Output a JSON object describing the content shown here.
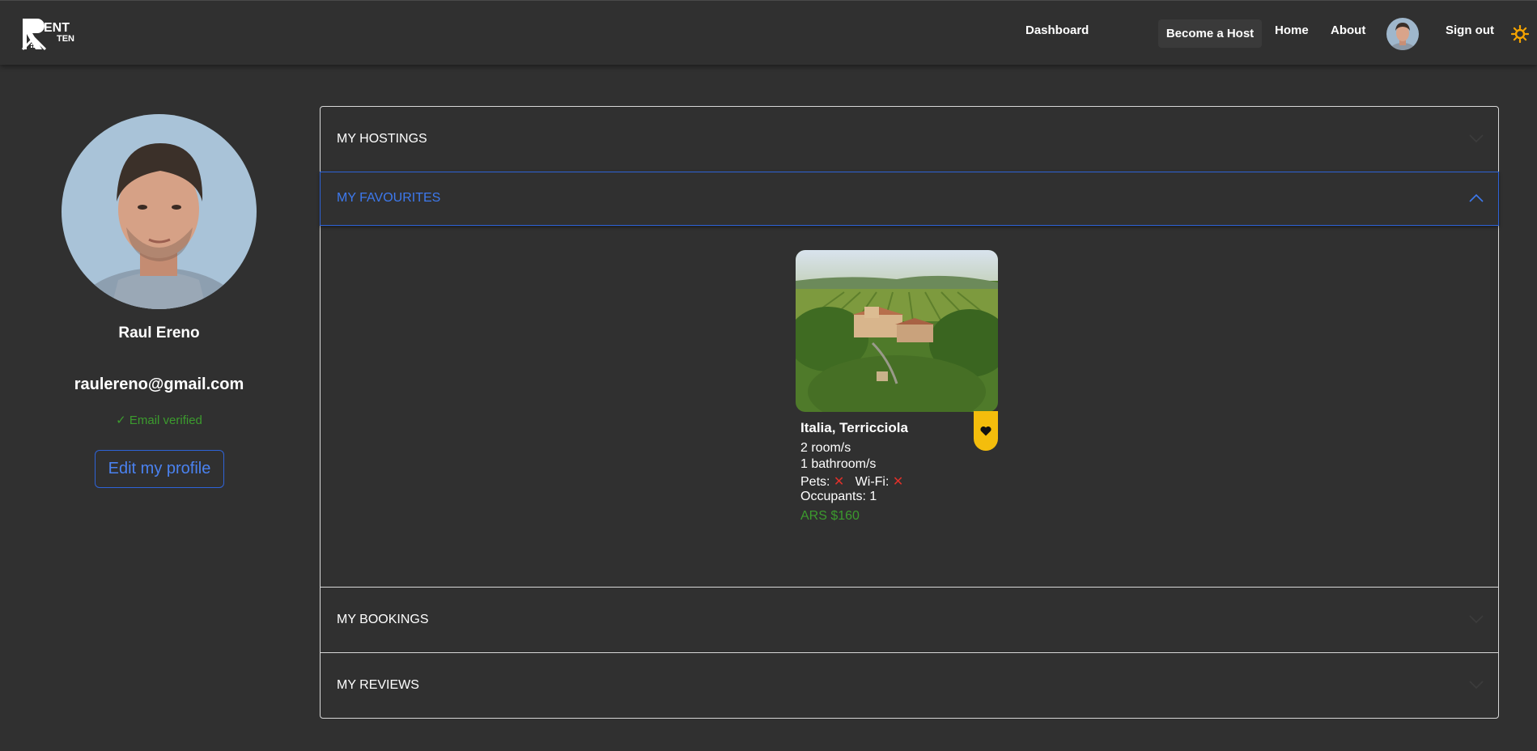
{
  "navbar": {
    "logo_text": "RENT TEN",
    "links": {
      "dashboard": "Dashboard",
      "become_host": "Become a Host",
      "home": "Home",
      "about": "About",
      "sign_out": "Sign out"
    },
    "theme_icon": "sun-icon"
  },
  "profile": {
    "name": "Raul Ereno",
    "email": "raulereno@gmail.com",
    "verified_text": "✓ Email verified",
    "edit_button": "Edit my profile"
  },
  "accordion": {
    "sections": [
      {
        "title": "MY HOSTINGS",
        "expanded": false
      },
      {
        "title": "MY FAVOURITES",
        "expanded": true
      },
      {
        "title": "MY BOOKINGS",
        "expanded": false
      },
      {
        "title": "MY REVIEWS",
        "expanded": false
      }
    ]
  },
  "favourite_card": {
    "title": "Italia, Terricciola",
    "rooms": "2 room/s",
    "bathrooms": "1 bathroom/s",
    "pets_label": "Pets:",
    "wifi_label": "Wi-Fi:",
    "pets_icon": "x-mark-icon",
    "wifi_icon": "x-mark-icon",
    "occupants": "Occupants: 1",
    "price": "ARS $160"
  },
  "colors": {
    "background": "#303030",
    "accent_blue": "#2e63d8",
    "verified_green": "#3c9b2e",
    "favourite_yellow": "#f4bd0c",
    "negative_red": "#e0302a"
  }
}
